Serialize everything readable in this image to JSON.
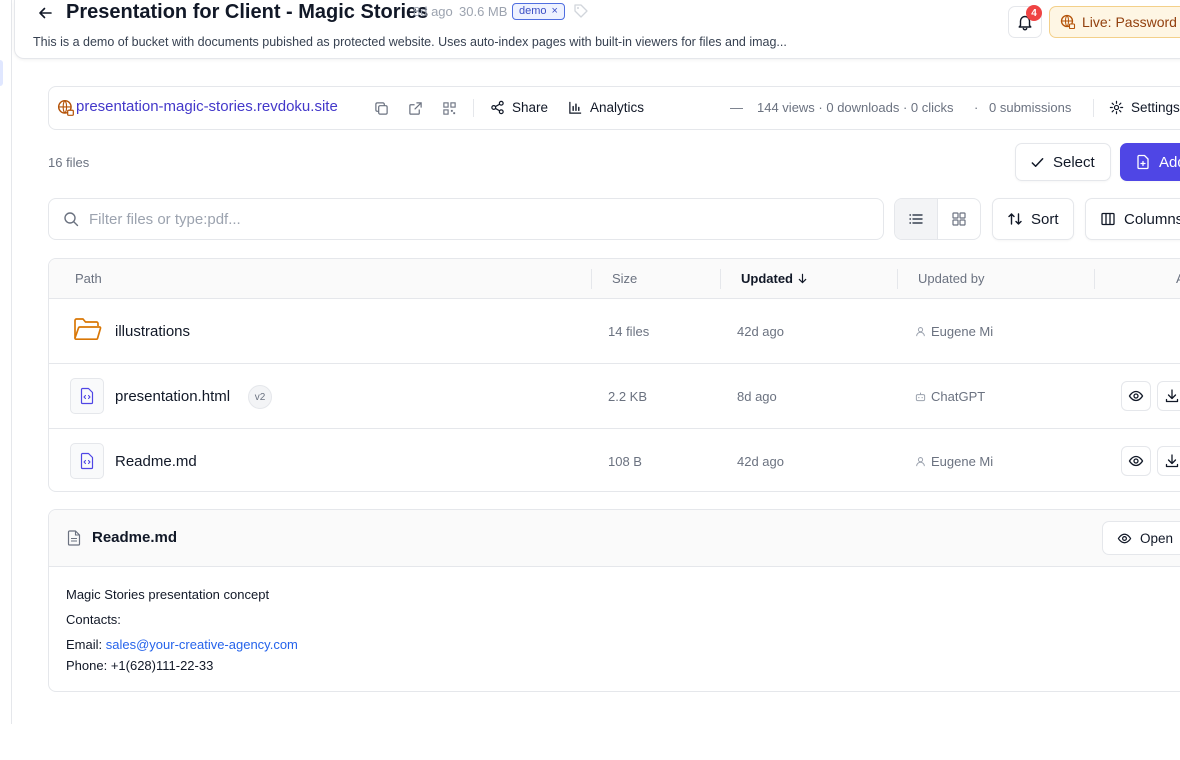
{
  "header": {
    "title": "Presentation for Client - Magic Stories",
    "updated": "8d ago",
    "size": "30.6 MB",
    "tag": "demo",
    "tag_remove": "×",
    "description": "This is a demo of bucket with documents pubished as protected website. Uses auto-index pages with built-in viewers for files and imag...",
    "notifications_count": "4",
    "live_label": "Live: Password"
  },
  "site": {
    "url": "presentation-magic-stories.revdoku.site",
    "share_label": "Share",
    "analytics_label": "Analytics",
    "dash": "—",
    "stats": "144 views · 0 downloads · 0 clicks",
    "stats_sep": "·",
    "submissions": "0 submissions",
    "settings_label": "Settings"
  },
  "toolbar": {
    "file_count": "16 files",
    "select_label": "Select",
    "add_label": "Add",
    "search_placeholder": "Filter files or type:pdf...",
    "sort_label": "Sort",
    "columns_label": "Columns"
  },
  "table": {
    "columns": {
      "path": "Path",
      "size": "Size",
      "updated": "Updated",
      "updated_by": "Updated by",
      "actions": "A"
    },
    "rows": [
      {
        "name": "illustrations",
        "version": "",
        "size": "14 files",
        "updated": "42d ago",
        "updated_by": "Eugene Mi",
        "kind": "folder"
      },
      {
        "name": "presentation.html",
        "version": "v2",
        "size": "2.2 KB",
        "updated": "8d ago",
        "updated_by": "ChatGPT",
        "kind": "file"
      },
      {
        "name": "Readme.md",
        "version": "",
        "size": "108 B",
        "updated": "42d ago",
        "updated_by": "Eugene Mi",
        "kind": "file"
      }
    ]
  },
  "readme": {
    "title": "Readme.md",
    "open_label": "Open",
    "line1": "Magic Stories presentation concept",
    "line2": "Contacts:",
    "email_label": "Email:",
    "email": "sales@your-creative-agency.com",
    "phone": "Phone: +1(628)111-22-33"
  },
  "colors": {
    "accent": "#4f46e5",
    "link": "#4338ca",
    "badge": "#ef4444",
    "live_bg": "#fef6e4",
    "folder": "#d97706"
  }
}
